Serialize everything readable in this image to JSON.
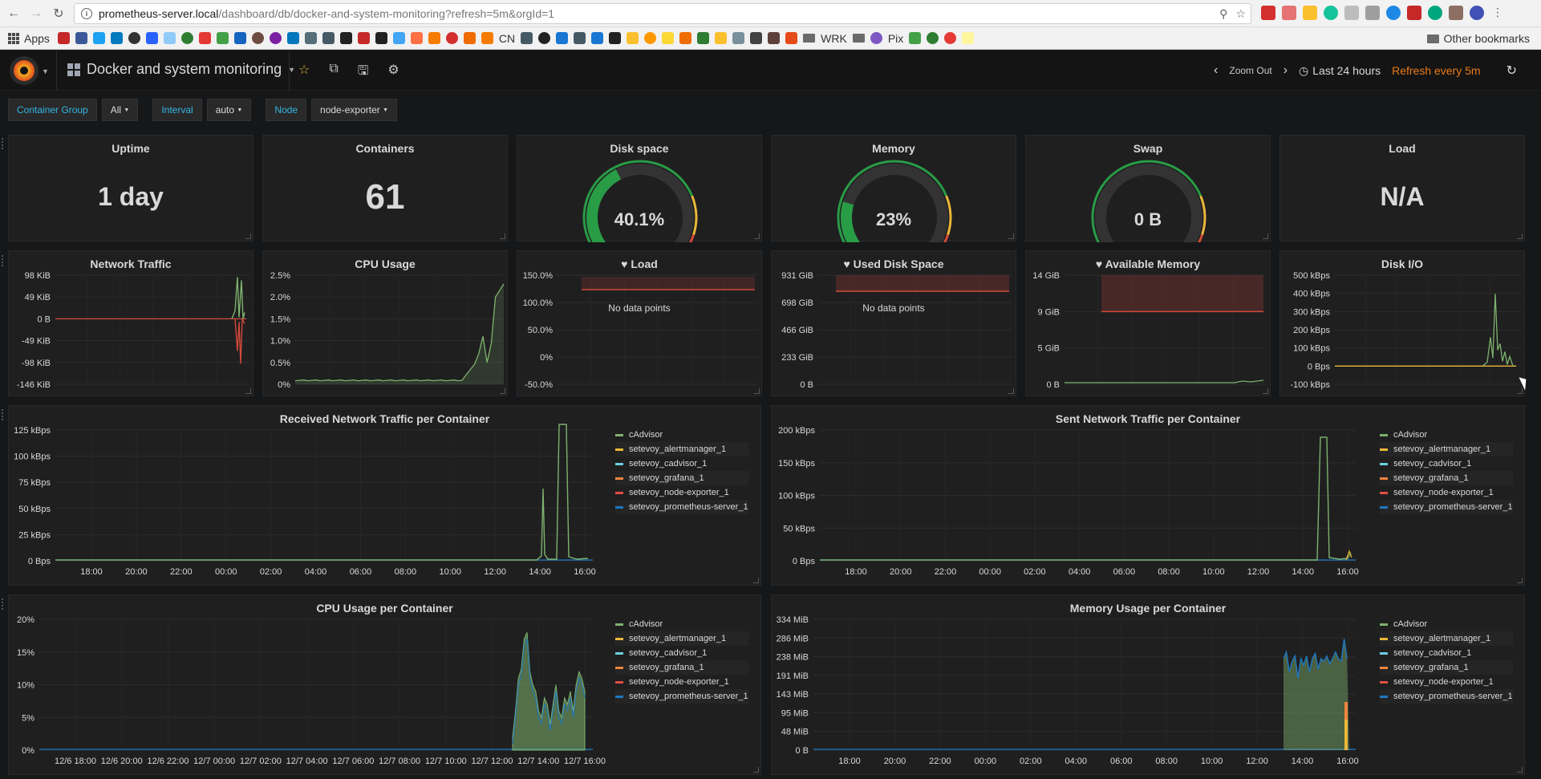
{
  "browser": {
    "url_host": "prometheus-server.local",
    "url_path": "/dashboard/db/docker-and-system-monitoring?refresh=5m&orgId=1",
    "bookmarks": {
      "apps_label": "Apps",
      "cn_label": "CN",
      "wrk_label": "WRK",
      "pix_label": "Pix",
      "other_label": "Other bookmarks"
    }
  },
  "navbar": {
    "dashboard_title": "Docker and system monitoring",
    "zoom_out": "Zoom Out",
    "time_range": "Last 24 hours",
    "refresh": "Refresh every 5m"
  },
  "variables": [
    {
      "label": "Container Group",
      "value": "All"
    },
    {
      "label": "Interval",
      "value": "auto"
    },
    {
      "label": "Node",
      "value": "node-exporter"
    }
  ],
  "stats": {
    "uptime": {
      "title": "Uptime",
      "value": "1 day"
    },
    "containers": {
      "title": "Containers",
      "value": "61"
    },
    "disk": {
      "title": "Disk space",
      "value": "40.1%",
      "fraction": 0.401
    },
    "memory": {
      "title": "Memory",
      "value": "23%",
      "fraction": 0.23
    },
    "swap": {
      "title": "Swap",
      "value": "0 B",
      "fraction": 0
    },
    "load": {
      "title": "Load",
      "value": "N/A"
    }
  },
  "small_graphs": {
    "network": {
      "title": "Network Traffic",
      "yticks": [
        "98 KiB",
        "49 KiB",
        "0 B",
        "-49 KiB",
        "-98 KiB",
        "-146 KiB"
      ]
    },
    "cpu": {
      "title": "CPU Usage",
      "yticks": [
        "2.5%",
        "2.0%",
        "1.5%",
        "1.0%",
        "0.5%",
        "0%"
      ]
    },
    "load": {
      "title": "Load",
      "yticks": [
        "150.0%",
        "100.0%",
        "50.0%",
        "0%",
        "-50.0%"
      ],
      "no_data": "No data points"
    },
    "used_disk": {
      "title": "Used Disk Space",
      "yticks": [
        "931 GiB",
        "698 GiB",
        "466 GiB",
        "233 GiB",
        "0 B"
      ],
      "no_data": "No data points"
    },
    "avail_mem": {
      "title": "Available Memory",
      "yticks": [
        "14 GiB",
        "9 GiB",
        "5 GiB",
        "0 B"
      ]
    },
    "disk_io": {
      "title": "Disk I/O",
      "yticks": [
        "500 kBps",
        "400 kBps",
        "300 kBps",
        "200 kBps",
        "100 kBps",
        "0 Bps",
        "-100 kBps"
      ]
    }
  },
  "large_graphs": {
    "received": {
      "title": "Received Network Traffic per Container",
      "yticks": [
        "125 kBps",
        "100 kBps",
        "75 kBps",
        "50 kBps",
        "25 kBps",
        "0 Bps"
      ],
      "xticks": [
        "18:00",
        "20:00",
        "22:00",
        "00:00",
        "02:00",
        "04:00",
        "06:00",
        "08:00",
        "10:00",
        "12:00",
        "14:00",
        "16:00"
      ]
    },
    "sent": {
      "title": "Sent Network Traffic per Container",
      "yticks": [
        "200 kBps",
        "150 kBps",
        "100 kBps",
        "50 kBps",
        "0 Bps"
      ],
      "xticks": [
        "18:00",
        "20:00",
        "22:00",
        "00:00",
        "02:00",
        "04:00",
        "06:00",
        "08:00",
        "10:00",
        "12:00",
        "14:00",
        "16:00"
      ]
    },
    "cpu_per_container": {
      "title": "CPU Usage per Container",
      "yticks": [
        "20%",
        "15%",
        "10%",
        "5%",
        "0%"
      ],
      "xticks": [
        "12/6 18:00",
        "12/6 20:00",
        "12/6 22:00",
        "12/7 00:00",
        "12/7 02:00",
        "12/7 04:00",
        "12/7 06:00",
        "12/7 08:00",
        "12/7 10:00",
        "12/7 12:00",
        "12/7 14:00",
        "12/7 16:00"
      ]
    },
    "mem_per_container": {
      "title": "Memory Usage per Container",
      "yticks": [
        "334 MiB",
        "286 MiB",
        "238 MiB",
        "191 MiB",
        "143 MiB",
        "95 MiB",
        "48 MiB",
        "0 B"
      ],
      "xticks": [
        "18:00",
        "20:00",
        "22:00",
        "00:00",
        "02:00",
        "04:00",
        "06:00",
        "08:00",
        "10:00",
        "12:00",
        "14:00",
        "16:00"
      ]
    }
  },
  "legend": [
    {
      "name": "cAdvisor",
      "color": "#7eb26d"
    },
    {
      "name": "setevoy_alertmanager_1",
      "color": "#eab839"
    },
    {
      "name": "setevoy_cadvisor_1",
      "color": "#6ed0e0"
    },
    {
      "name": "setevoy_grafana_1",
      "color": "#ef843c"
    },
    {
      "name": "setevoy_node-exporter_1",
      "color": "#e24d42"
    },
    {
      "name": "setevoy_prometheus-server_1",
      "color": "#1f78c1"
    }
  ],
  "colors": {
    "accent_blue": "#33b5e5",
    "refresh_orange": "#eb7b18",
    "gauge_green": "#299c46",
    "gauge_track": "#333333",
    "threshold_red": "#d44a3a"
  }
}
